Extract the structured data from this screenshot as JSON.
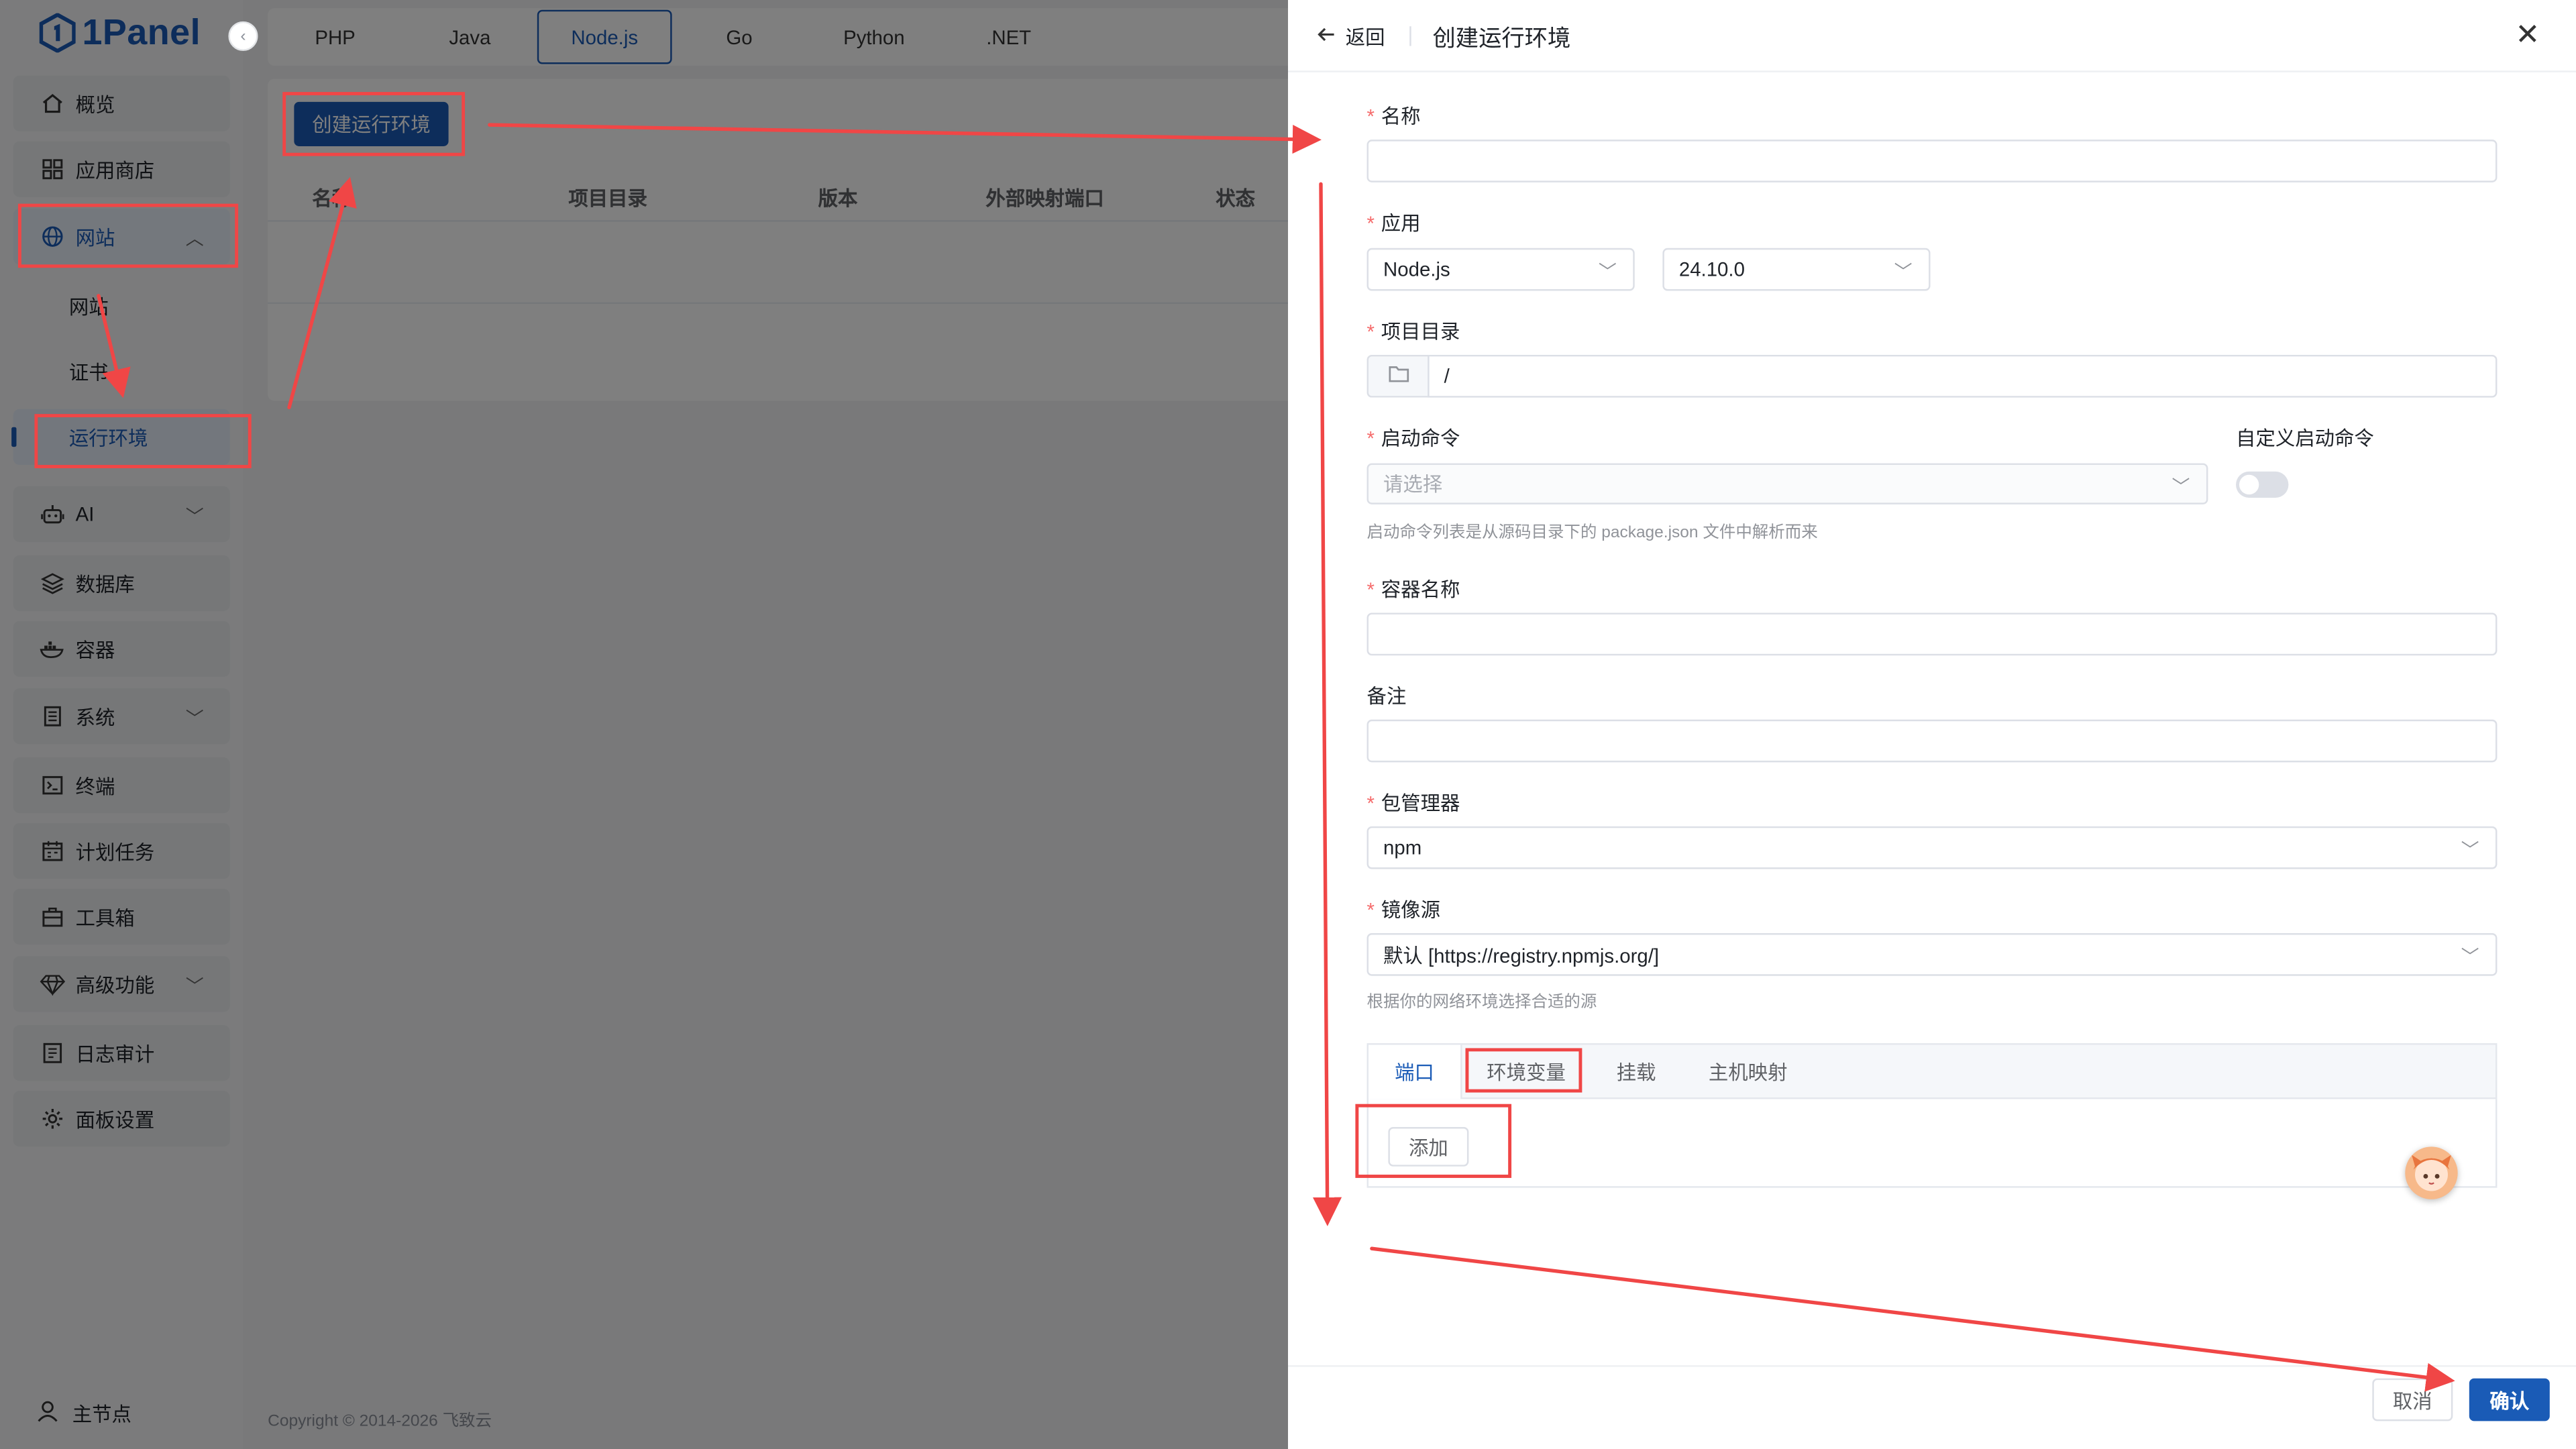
{
  "app": {
    "logo_text": "1Panel",
    "brand_color": "#1a5bb6"
  },
  "sidebar": {
    "collapse_glyph": "‹",
    "items": [
      {
        "label": "概览",
        "icon": "home-icon"
      },
      {
        "label": "应用商店",
        "icon": "grid-icon"
      },
      {
        "label": "网站",
        "icon": "globe-icon",
        "expanded": true
      },
      {
        "label": "AI",
        "icon": "robot-icon"
      },
      {
        "label": "数据库",
        "icon": "layers-icon"
      },
      {
        "label": "容器",
        "icon": "docker-icon"
      },
      {
        "label": "系统",
        "icon": "server-icon"
      },
      {
        "label": "终端",
        "icon": "terminal-icon"
      },
      {
        "label": "计划任务",
        "icon": "calendar-icon"
      },
      {
        "label": "工具箱",
        "icon": "toolbox-icon"
      },
      {
        "label": "高级功能",
        "icon": "diamond-icon"
      },
      {
        "label": "日志审计",
        "icon": "log-icon"
      },
      {
        "label": "面板设置",
        "icon": "gear-icon"
      }
    ],
    "website_sub": [
      "网站",
      "证书",
      "运行环境"
    ],
    "active_sub": "运行环境",
    "node_label": "主节点"
  },
  "main": {
    "runtime_tabs": [
      "PHP",
      "Java",
      "Node.js",
      "Go",
      "Python",
      ".NET"
    ],
    "active_tab": "Node.js",
    "create_button": "创建运行环境",
    "table_headers": [
      "名称",
      "项目目录",
      "版本",
      "外部映射端口",
      "状态"
    ],
    "copyright": "Copyright © 2014-2026 飞致云"
  },
  "drawer": {
    "back_label": "返回",
    "title": "创建运行环境",
    "fields": {
      "name": {
        "label": "名称",
        "value": ""
      },
      "app": {
        "label": "应用",
        "app_value": "Node.js",
        "version_value": "24.10.0"
      },
      "project_dir": {
        "label": "项目目录",
        "value": "/"
      },
      "start_cmd": {
        "label": "启动命令",
        "placeholder": "请选择",
        "hint": "启动命令列表是从源码目录下的 package.json 文件中解析而来"
      },
      "custom_start": {
        "label": "自定义启动命令",
        "enabled": false
      },
      "container_name": {
        "label": "容器名称",
        "value": ""
      },
      "remark": {
        "label": "备注",
        "value": ""
      },
      "package_manager": {
        "label": "包管理器",
        "value": "npm"
      },
      "mirror": {
        "label": "镜像源",
        "value": "默认 [https://registry.npmjs.org/]",
        "hint": "根据你的网络环境选择合适的源"
      }
    },
    "sub_tabs": [
      "端口",
      "环境变量",
      "挂载",
      "主机映射"
    ],
    "active_sub_tab": "端口",
    "add_button": "添加",
    "cancel_button": "取消",
    "confirm_button": "确认"
  },
  "annotation_color": "#f04646"
}
